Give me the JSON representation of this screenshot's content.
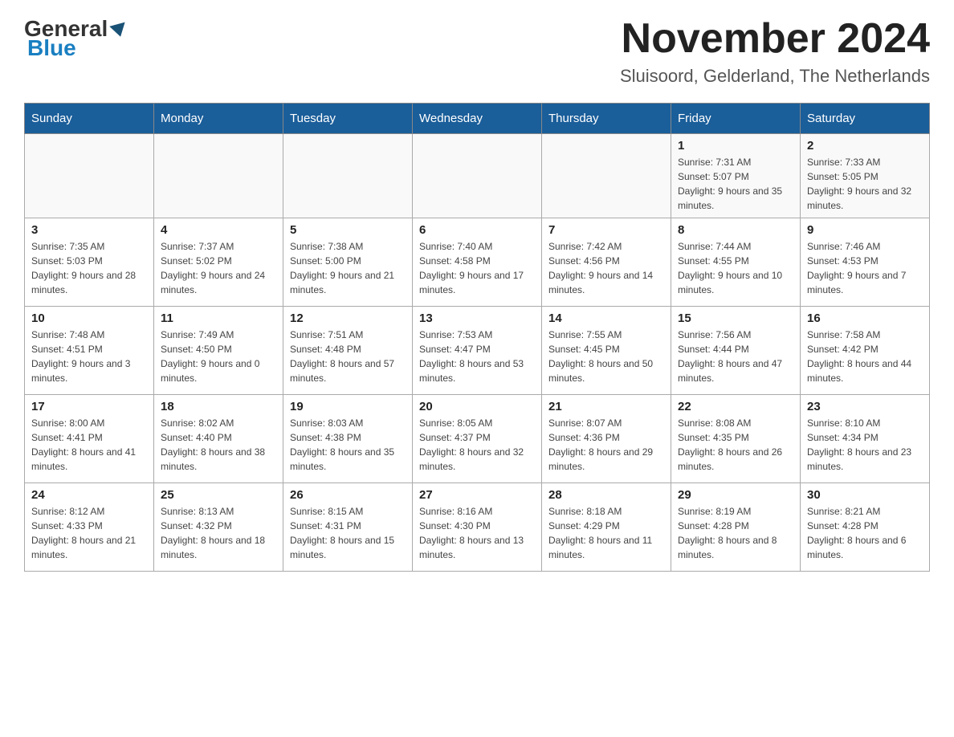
{
  "header": {
    "logo": {
      "general": "General",
      "blue": "Blue"
    },
    "title": "November 2024",
    "location": "Sluisoord, Gelderland, The Netherlands"
  },
  "weekdays": [
    "Sunday",
    "Monday",
    "Tuesday",
    "Wednesday",
    "Thursday",
    "Friday",
    "Saturday"
  ],
  "weeks": [
    [
      {
        "day": "",
        "info": ""
      },
      {
        "day": "",
        "info": ""
      },
      {
        "day": "",
        "info": ""
      },
      {
        "day": "",
        "info": ""
      },
      {
        "day": "",
        "info": ""
      },
      {
        "day": "1",
        "info": "Sunrise: 7:31 AM\nSunset: 5:07 PM\nDaylight: 9 hours and 35 minutes."
      },
      {
        "day": "2",
        "info": "Sunrise: 7:33 AM\nSunset: 5:05 PM\nDaylight: 9 hours and 32 minutes."
      }
    ],
    [
      {
        "day": "3",
        "info": "Sunrise: 7:35 AM\nSunset: 5:03 PM\nDaylight: 9 hours and 28 minutes."
      },
      {
        "day": "4",
        "info": "Sunrise: 7:37 AM\nSunset: 5:02 PM\nDaylight: 9 hours and 24 minutes."
      },
      {
        "day": "5",
        "info": "Sunrise: 7:38 AM\nSunset: 5:00 PM\nDaylight: 9 hours and 21 minutes."
      },
      {
        "day": "6",
        "info": "Sunrise: 7:40 AM\nSunset: 4:58 PM\nDaylight: 9 hours and 17 minutes."
      },
      {
        "day": "7",
        "info": "Sunrise: 7:42 AM\nSunset: 4:56 PM\nDaylight: 9 hours and 14 minutes."
      },
      {
        "day": "8",
        "info": "Sunrise: 7:44 AM\nSunset: 4:55 PM\nDaylight: 9 hours and 10 minutes."
      },
      {
        "day": "9",
        "info": "Sunrise: 7:46 AM\nSunset: 4:53 PM\nDaylight: 9 hours and 7 minutes."
      }
    ],
    [
      {
        "day": "10",
        "info": "Sunrise: 7:48 AM\nSunset: 4:51 PM\nDaylight: 9 hours and 3 minutes."
      },
      {
        "day": "11",
        "info": "Sunrise: 7:49 AM\nSunset: 4:50 PM\nDaylight: 9 hours and 0 minutes."
      },
      {
        "day": "12",
        "info": "Sunrise: 7:51 AM\nSunset: 4:48 PM\nDaylight: 8 hours and 57 minutes."
      },
      {
        "day": "13",
        "info": "Sunrise: 7:53 AM\nSunset: 4:47 PM\nDaylight: 8 hours and 53 minutes."
      },
      {
        "day": "14",
        "info": "Sunrise: 7:55 AM\nSunset: 4:45 PM\nDaylight: 8 hours and 50 minutes."
      },
      {
        "day": "15",
        "info": "Sunrise: 7:56 AM\nSunset: 4:44 PM\nDaylight: 8 hours and 47 minutes."
      },
      {
        "day": "16",
        "info": "Sunrise: 7:58 AM\nSunset: 4:42 PM\nDaylight: 8 hours and 44 minutes."
      }
    ],
    [
      {
        "day": "17",
        "info": "Sunrise: 8:00 AM\nSunset: 4:41 PM\nDaylight: 8 hours and 41 minutes."
      },
      {
        "day": "18",
        "info": "Sunrise: 8:02 AM\nSunset: 4:40 PM\nDaylight: 8 hours and 38 minutes."
      },
      {
        "day": "19",
        "info": "Sunrise: 8:03 AM\nSunset: 4:38 PM\nDaylight: 8 hours and 35 minutes."
      },
      {
        "day": "20",
        "info": "Sunrise: 8:05 AM\nSunset: 4:37 PM\nDaylight: 8 hours and 32 minutes."
      },
      {
        "day": "21",
        "info": "Sunrise: 8:07 AM\nSunset: 4:36 PM\nDaylight: 8 hours and 29 minutes."
      },
      {
        "day": "22",
        "info": "Sunrise: 8:08 AM\nSunset: 4:35 PM\nDaylight: 8 hours and 26 minutes."
      },
      {
        "day": "23",
        "info": "Sunrise: 8:10 AM\nSunset: 4:34 PM\nDaylight: 8 hours and 23 minutes."
      }
    ],
    [
      {
        "day": "24",
        "info": "Sunrise: 8:12 AM\nSunset: 4:33 PM\nDaylight: 8 hours and 21 minutes."
      },
      {
        "day": "25",
        "info": "Sunrise: 8:13 AM\nSunset: 4:32 PM\nDaylight: 8 hours and 18 minutes."
      },
      {
        "day": "26",
        "info": "Sunrise: 8:15 AM\nSunset: 4:31 PM\nDaylight: 8 hours and 15 minutes."
      },
      {
        "day": "27",
        "info": "Sunrise: 8:16 AM\nSunset: 4:30 PM\nDaylight: 8 hours and 13 minutes."
      },
      {
        "day": "28",
        "info": "Sunrise: 8:18 AM\nSunset: 4:29 PM\nDaylight: 8 hours and 11 minutes."
      },
      {
        "day": "29",
        "info": "Sunrise: 8:19 AM\nSunset: 4:28 PM\nDaylight: 8 hours and 8 minutes."
      },
      {
        "day": "30",
        "info": "Sunrise: 8:21 AM\nSunset: 4:28 PM\nDaylight: 8 hours and 6 minutes."
      }
    ]
  ]
}
